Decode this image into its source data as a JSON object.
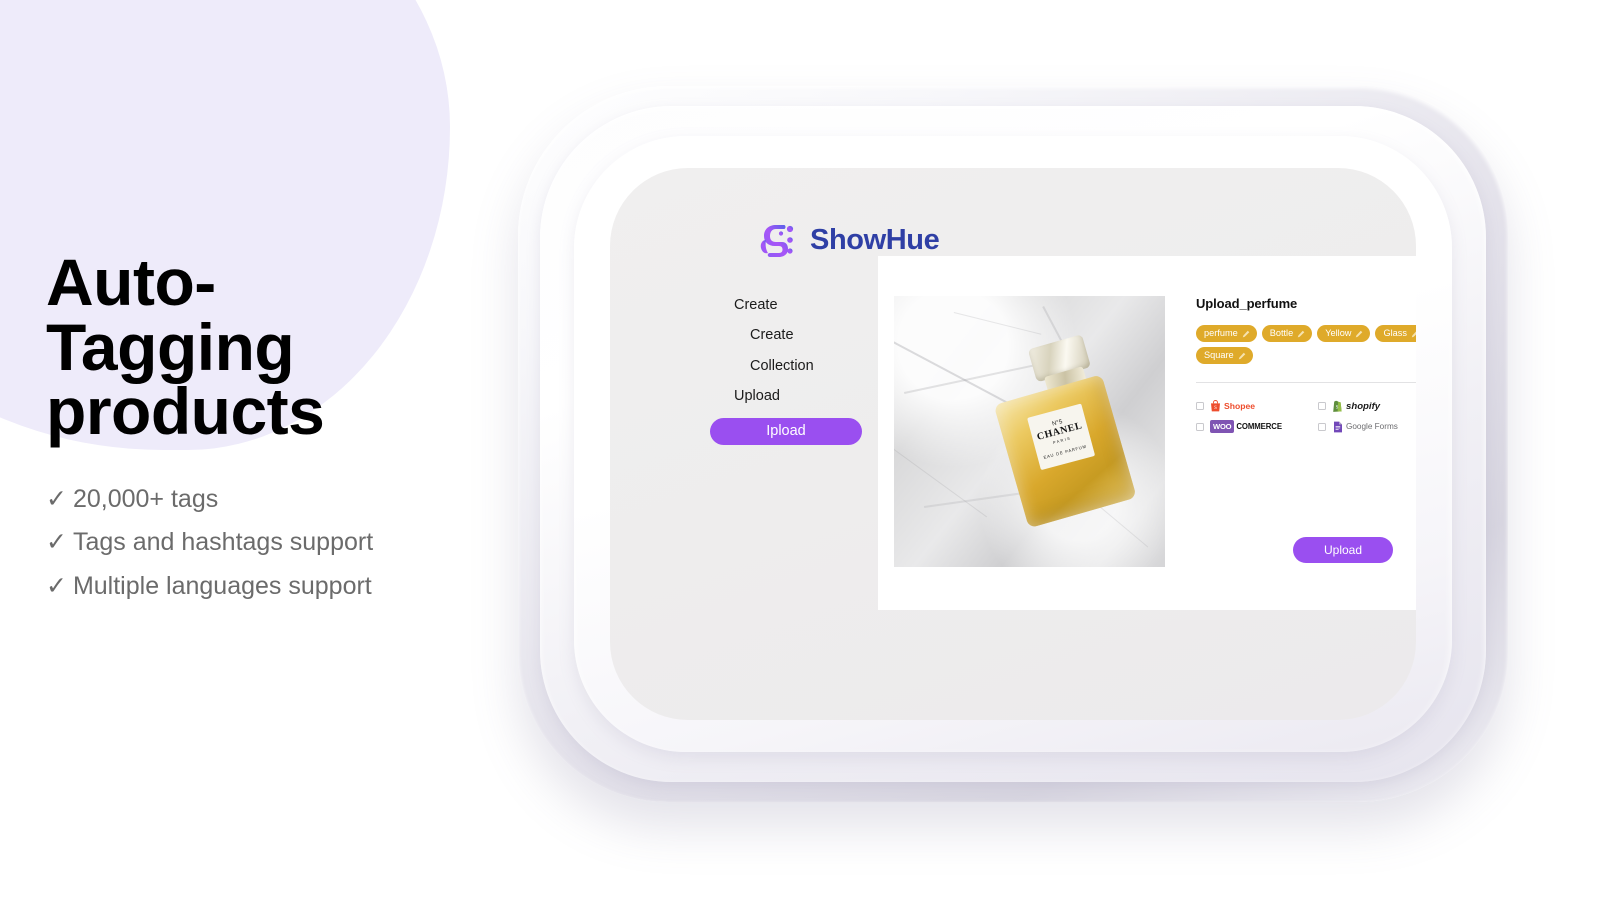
{
  "promo": {
    "headline_lines": [
      "Auto-",
      "Tagging",
      "products"
    ],
    "bullets": [
      {
        "tick": "✓",
        "text": "20,000+ tags"
      },
      {
        "tick": "✓",
        "text": "Tags and hashtags support"
      },
      {
        "tick": "✓",
        "text": "Multiple languages support"
      }
    ]
  },
  "app": {
    "brand_name": "ShowHue",
    "brand_icon": "showhue-logo-icon",
    "sidebar": {
      "groups": [
        {
          "label": "Create",
          "items": [
            {
              "label": "Create",
              "active": false
            },
            {
              "label": "Collection",
              "active": false
            }
          ]
        },
        {
          "label": "Upload",
          "items": [
            {
              "label": "Ipload",
              "active": true
            }
          ]
        }
      ]
    },
    "detail": {
      "title": "Upload_perfume",
      "tags": [
        {
          "label": "perfume",
          "icon": "edit-pencil-icon"
        },
        {
          "label": "Bottle",
          "icon": "edit-pencil-icon"
        },
        {
          "label": "Yellow",
          "icon": "edit-pencil-icon"
        },
        {
          "label": "Glass",
          "icon": "edit-pencil-icon"
        },
        {
          "label": "Square",
          "icon": "edit-pencil-icon"
        }
      ],
      "platforms": [
        {
          "name": "Shopee",
          "icon": "shopee-bag-icon",
          "checked": false
        },
        {
          "name": "shopify",
          "icon": "shopify-bag-icon",
          "checked": false
        },
        {
          "name": "WOO COMMERCE",
          "icon": "woocommerce-icon",
          "checked": false
        },
        {
          "name": "Google Forms",
          "icon": "google-forms-icon",
          "checked": false
        }
      ],
      "upload_button": "Upload"
    },
    "product_image": {
      "alt": "perfume-bottle-on-marble",
      "label_no": "N°5",
      "label_brand": "CHANEL",
      "label_city": "PARIS",
      "label_edp": "EAU DE PARFUM"
    }
  },
  "colors": {
    "accent_purple": "#9a4ff0",
    "brand_blue": "#2f3fa5",
    "tag_gold": "#dfaa2a",
    "blob_lavender": "#eeebfa",
    "screen_gray": "#eeeded",
    "body_text": "#6b6b6b"
  }
}
